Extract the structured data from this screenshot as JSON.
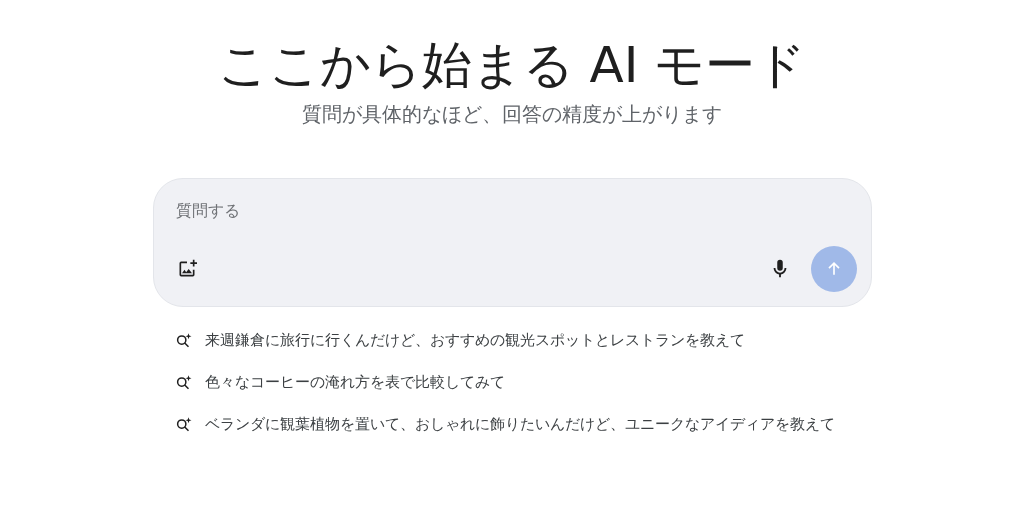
{
  "title": "ここから始まる AI モード",
  "subtitle": "質問が具体的なほど、回答の精度が上がります",
  "input": {
    "placeholder": "質問する",
    "submit_disabled": true
  },
  "suggestions": [
    {
      "text": "来週鎌倉に旅行に行くんだけど、おすすめの観光スポットとレストランを教えて"
    },
    {
      "text": "色々なコーヒーの淹れ方を表で比較してみて"
    },
    {
      "text": "ベランダに観葉植物を置いて、おしゃれに飾りたいんだけど、ユニークなアイディアを教えて"
    }
  ]
}
